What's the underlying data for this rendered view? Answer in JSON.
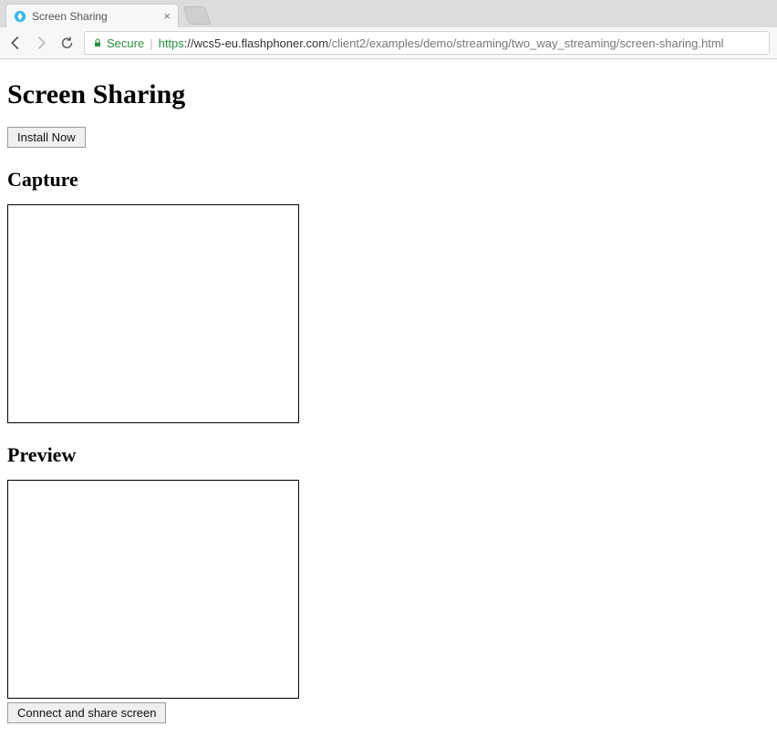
{
  "browser": {
    "tab_title": "Screen Sharing",
    "secure_label": "Secure",
    "url_scheme": "https",
    "url_host": "://wcs5-eu.flashphoner.com",
    "url_path": "/client2/examples/demo/streaming/two_way_streaming/screen-sharing.html"
  },
  "page": {
    "title": "Screen Sharing",
    "install_button": "Install Now",
    "capture_heading": "Capture",
    "preview_heading": "Preview",
    "connect_button": "Connect and share screen"
  }
}
